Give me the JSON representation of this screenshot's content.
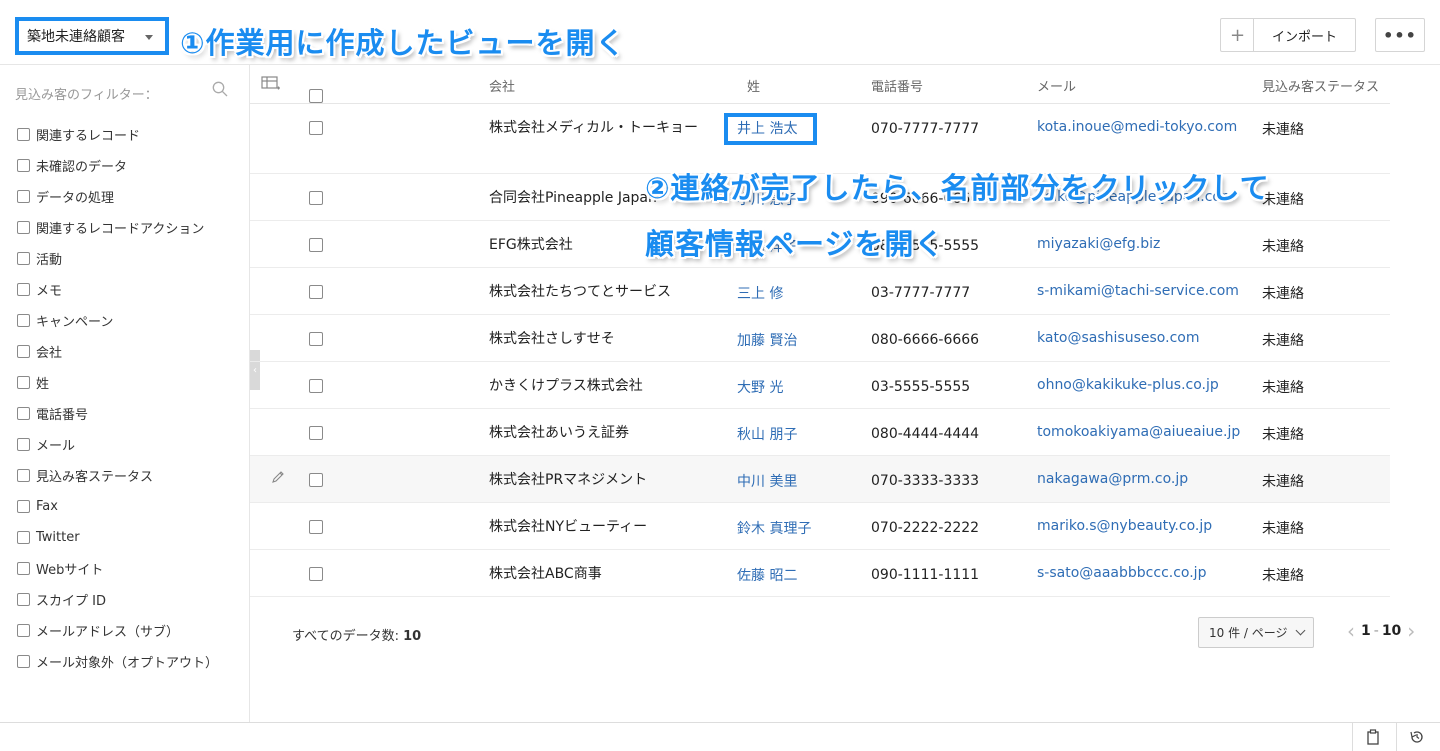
{
  "view": {
    "selected": "築地未連絡顧客"
  },
  "callouts": {
    "step1": "①作業用に作成したビューを開く",
    "step2_line1": "②連絡が完了したら、名前部分をクリックして",
    "step2_line2": "顧客情報ページを開く"
  },
  "toolbar": {
    "plus": "+",
    "import_label": "インポート",
    "more": "•••"
  },
  "sidebar": {
    "title": "見込み客のフィルター：",
    "filters": [
      "関連するレコード",
      "未確認のデータ",
      "データの処理",
      "関連するレコードアクション",
      "活動",
      "メモ",
      "キャンペーン",
      "会社",
      "姓",
      "電話番号",
      "メール",
      "見込み客ステータス",
      "Fax",
      "Twitter",
      "Webサイト",
      "スカイプ ID",
      "メールアドレス（サブ）",
      "メール対象外（オプトアウト）"
    ]
  },
  "table": {
    "headers": {
      "company": "会社",
      "name": "姓",
      "phone": "電話番号",
      "mail": "メール",
      "status": "見込み客ステータス"
    },
    "rows": [
      {
        "company": "株式会社メディカル・トーキョー",
        "name": "井上 浩太",
        "phone": "070-7777-7777",
        "mail": "kota.inoue@medi-tokyo.com",
        "status": "未連絡"
      },
      {
        "company": "合同会社Pineapple Japan",
        "name": "小川 恵子",
        "phone": "090-6666-6666",
        "mail": "keiko@pineapple-japan.com",
        "status": "未連絡"
      },
      {
        "company": "EFG株式会社",
        "name": "宮崎 洋子",
        "phone": "080-5555-5555",
        "mail": "miyazaki@efg.biz",
        "status": "未連絡"
      },
      {
        "company": "株式会社たちつてとサービス",
        "name": "三上 修",
        "phone": "03-7777-7777",
        "mail": "s-mikami@tachi-service.com",
        "status": "未連絡"
      },
      {
        "company": "株式会社さしすせそ",
        "name": "加藤 賢治",
        "phone": "080-6666-6666",
        "mail": "kato@sashisuseso.com",
        "status": "未連絡"
      },
      {
        "company": "かきくけプラス株式会社",
        "name": "大野 光",
        "phone": "03-5555-5555",
        "mail": "ohno@kakikuke-plus.co.jp",
        "status": "未連絡"
      },
      {
        "company": "株式会社あいうえ証券",
        "name": "秋山 朋子",
        "phone": "080-4444-4444",
        "mail": "tomokoakiyama@aiueaiue.jp",
        "status": "未連絡"
      },
      {
        "company": "株式会社PRマネジメント",
        "name": "中川 美里",
        "phone": "070-3333-3333",
        "mail": "nakagawa@prm.co.jp",
        "status": "未連絡"
      },
      {
        "company": "株式会社NYビューティー",
        "name": "鈴木 真理子",
        "phone": "070-2222-2222",
        "mail": "mariko.s@nybeauty.co.jp",
        "status": "未連絡"
      },
      {
        "company": "株式会社ABC商事",
        "name": "佐藤 昭二",
        "phone": "090-1111-1111",
        "mail": "s-sato@aaabbbccc.co.jp",
        "status": "未連絡"
      }
    ]
  },
  "footer": {
    "total_label": "すべてのデータ数:",
    "total_count": "10",
    "per_page": "10 件 / ページ",
    "range_start": "1",
    "range_sep": "-",
    "range_end": "10"
  },
  "colors": {
    "accent": "#1a8cf0",
    "link": "#2f6db5"
  }
}
